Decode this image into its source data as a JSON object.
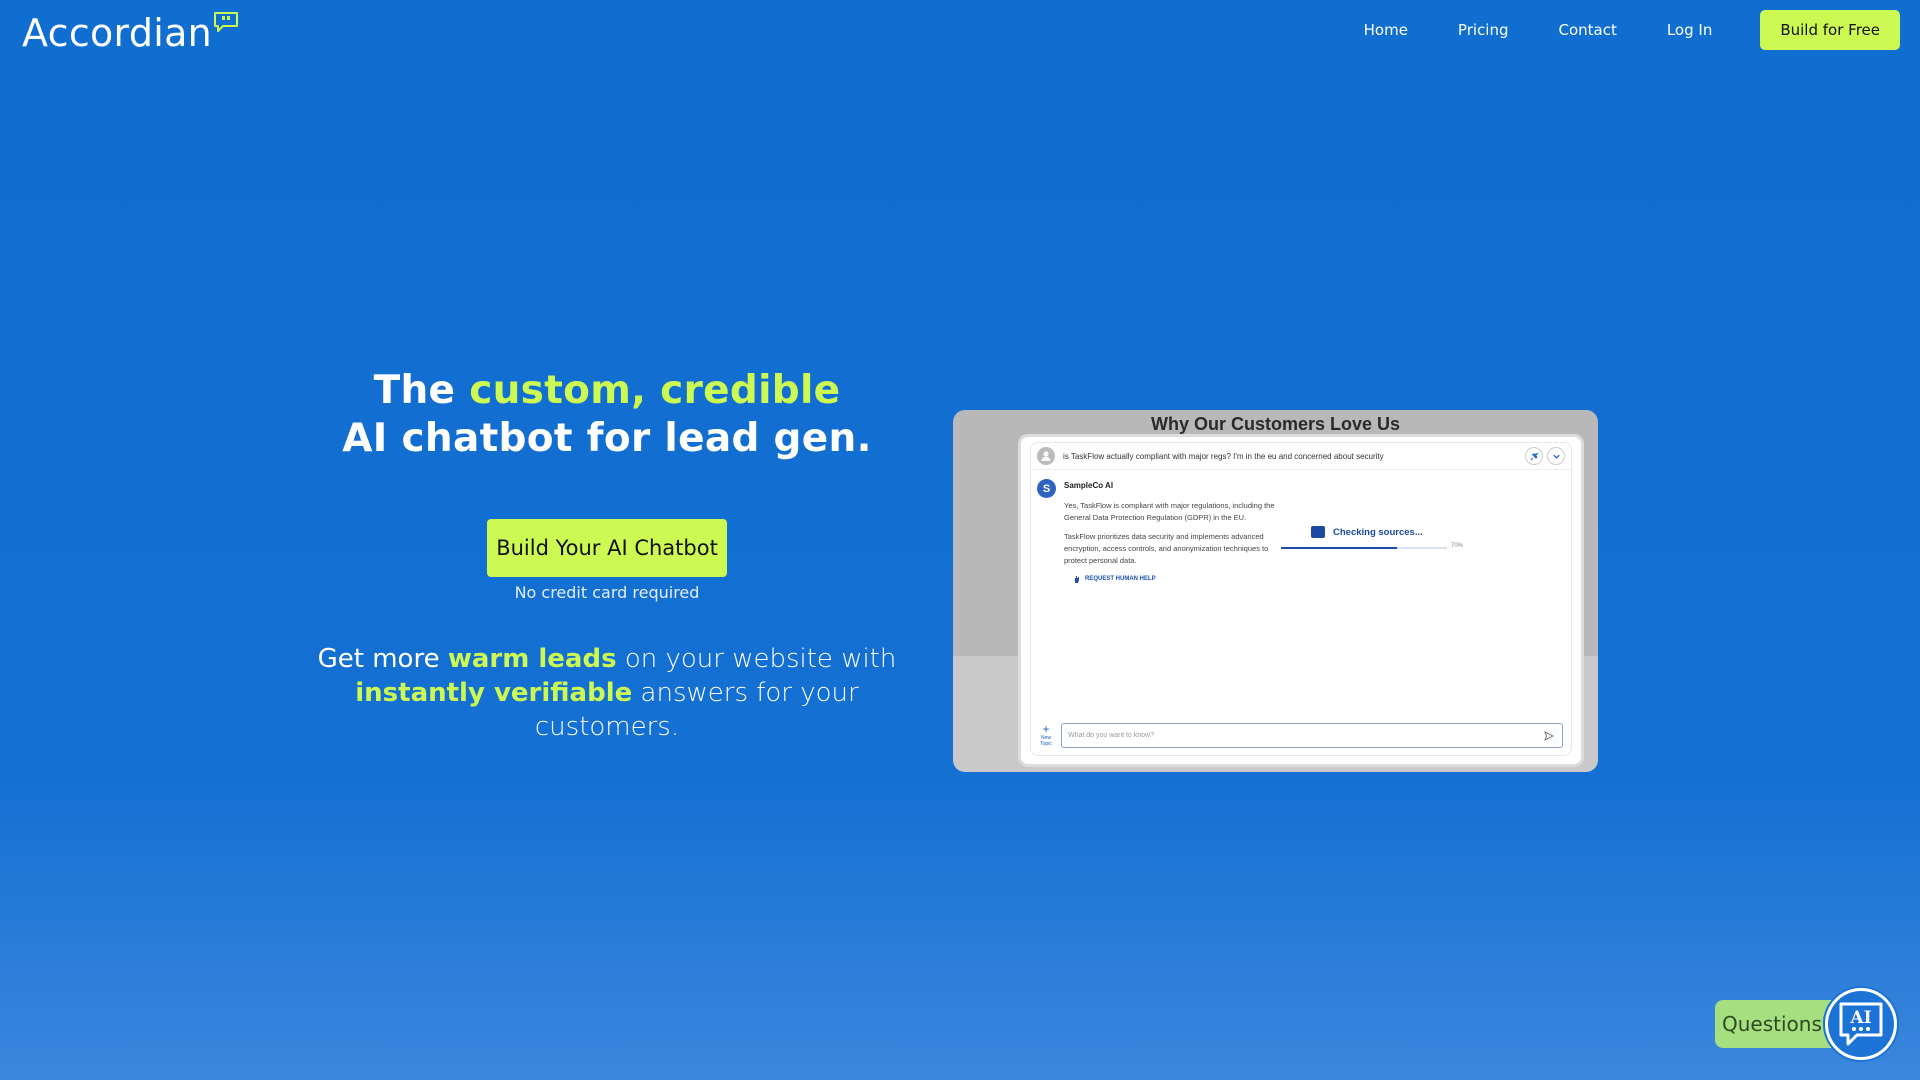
{
  "brand": {
    "name": "Accordian",
    "accent": "#cdfa52",
    "primary": "#1470d3"
  },
  "nav": {
    "items": [
      "Home",
      "Pricing",
      "Contact",
      "Log In"
    ],
    "cta": "Build for Free"
  },
  "hero": {
    "headline_1": "The ",
    "headline_hl": "custom, credible",
    "headline_2": "AI chatbot for lead gen.",
    "cta": "Build Your AI Chatbot",
    "cta_note": "No credit card required",
    "sub_1": "Get more ",
    "sub_hl1": "warm leads",
    "sub_2": " on your website with ",
    "sub_hl2": "instantly verifiable",
    "sub_3": " answers for your customers."
  },
  "demo": {
    "title": "Why Our Customers Love Us",
    "question": "is TaskFlow actually compliant with major regs? I'm in the eu and concerned about security",
    "ai_initial": "S",
    "ai_name": "SampleCo AI",
    "answer_p1": "Yes, TaskFlow is compliant with major regulations, including the General Data Protection Regulation (GDPR) in the EU.",
    "answer_p2": "TaskFlow prioritizes data security and implements advanced encryption, access controls, and anonymization techniques to protect personal data.",
    "request_help": "REQUEST HUMAN HELP",
    "checking": "Checking sources...",
    "progress": 0.7,
    "progress_label": "70%",
    "new_topic": "New Topic",
    "input_placeholder": "What do you want to know?",
    "icons": [
      "pin-icon",
      "chevron-down-icon",
      "user-icon",
      "hand-icon",
      "document-icon",
      "send-icon",
      "plus-icon"
    ]
  },
  "widget": {
    "label": "Questions?",
    "badge": "AI"
  }
}
